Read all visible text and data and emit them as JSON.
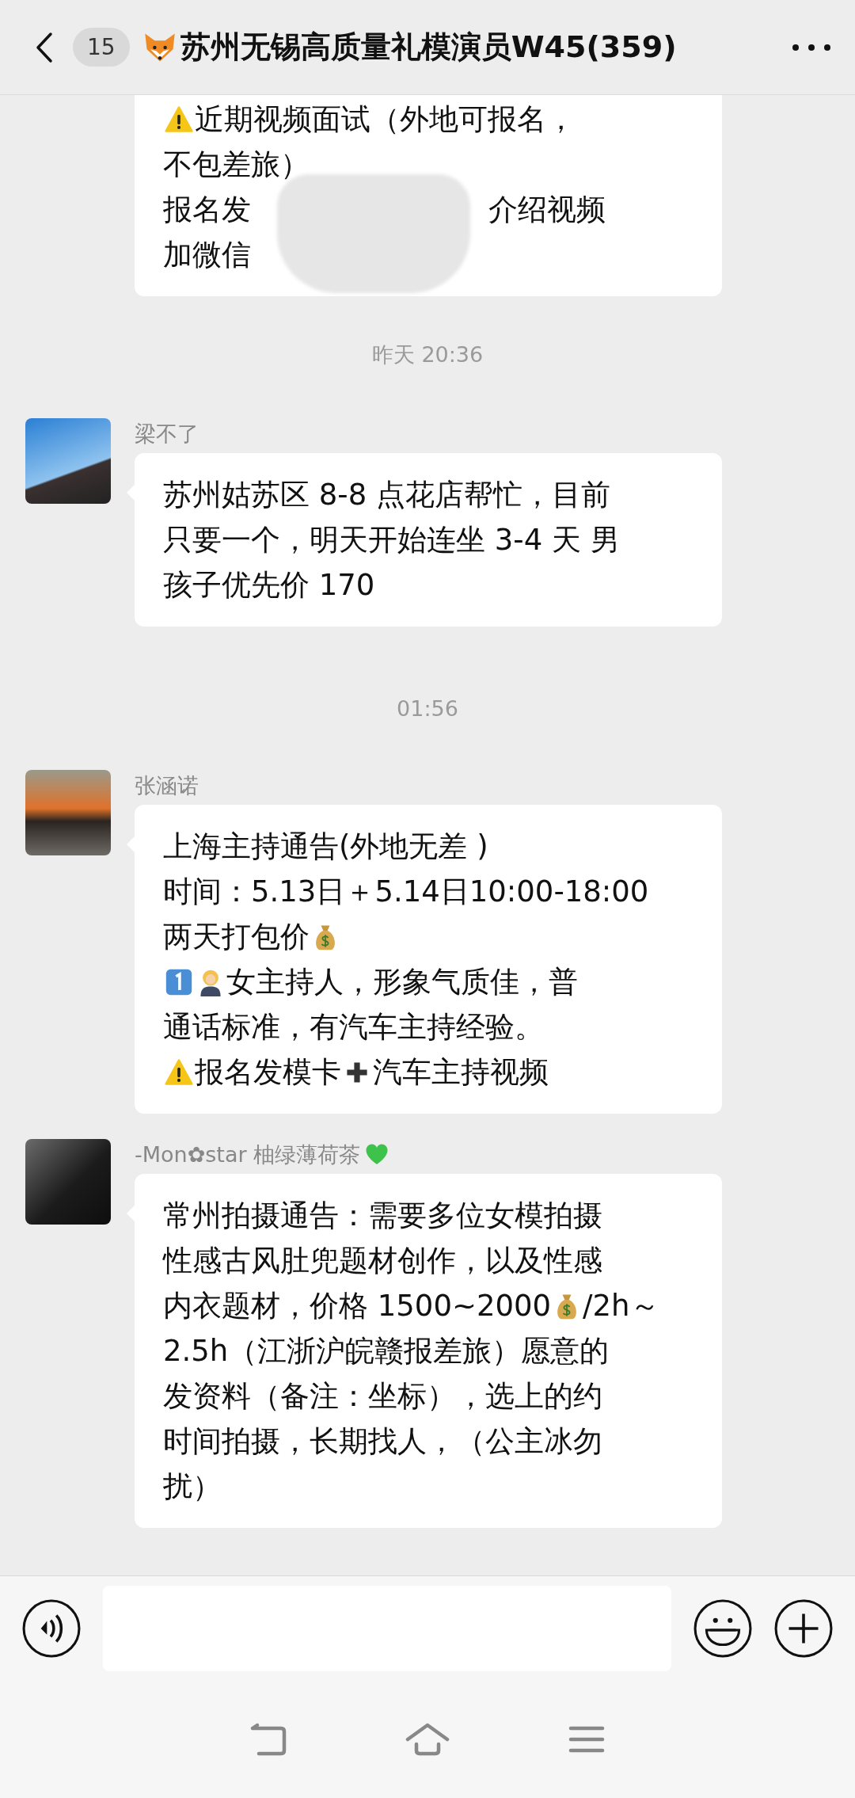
{
  "header": {
    "unread_count": "15",
    "title": "苏州无锡高质量礼模演员W45(359)"
  },
  "messages": [
    {
      "kind": "message",
      "redacted": true,
      "lines": [
        [
          {
            "kind": "warning"
          },
          {
            "kind": "text",
            "text": "近期视频面试（外地可报名，"
          }
        ],
        [
          {
            "kind": "text",
            "text": "不包差旅）"
          }
        ],
        [
          {
            "kind": "text",
            "text": "报名发"
          },
          {
            "kind": "hidden"
          },
          {
            "kind": "text",
            "text": "介绍视频"
          }
        ],
        [
          {
            "kind": "text",
            "text": "加微信"
          }
        ]
      ]
    },
    {
      "kind": "time",
      "text": "昨天 20:36"
    },
    {
      "kind": "message",
      "avatar": true,
      "sender": [
        {
          "kind": "text",
          "text": "梁不了"
        }
      ],
      "lines": [
        [
          {
            "kind": "text",
            "text": "苏州姑苏区 8-8 点花店帮忙，目前"
          }
        ],
        [
          {
            "kind": "text",
            "text": "只要一个，明天开始连坐 3-4 天 男"
          }
        ],
        [
          {
            "kind": "text",
            "text": "孩子优先价 170"
          }
        ]
      ]
    },
    {
      "kind": "time",
      "text": "01:56"
    },
    {
      "kind": "message",
      "avatar": true,
      "sender": [
        {
          "kind": "text",
          "text": "张涵诺"
        }
      ],
      "lines": [
        [
          {
            "kind": "text",
            "text": "上海主持通告(外地无差 )"
          }
        ],
        [
          {
            "kind": "text",
            "text": "时间：5.13日＋5.14日10:00-18:00"
          }
        ],
        [
          {
            "kind": "text",
            "text": "两天打包价"
          },
          {
            "kind": "money"
          }
        ],
        [
          {
            "kind": "keycap"
          },
          {
            "kind": "woman"
          },
          {
            "kind": "text",
            "text": "女主持人，形象气质佳，普"
          }
        ],
        [
          {
            "kind": "text",
            "text": "通话标准，有汽车主持经验。"
          }
        ],
        [
          {
            "kind": "warning"
          },
          {
            "kind": "text",
            "text": "报名发模卡"
          },
          {
            "kind": "plus"
          },
          {
            "kind": "text",
            "text": "汽车主持视频"
          }
        ]
      ]
    },
    {
      "kind": "message",
      "avatar": true,
      "sender": [
        {
          "kind": "text",
          "text": "-Mon✿star 柚绿薄荷茶"
        },
        {
          "kind": "heart"
        }
      ],
      "lines": [
        [
          {
            "kind": "text",
            "text": "常州拍摄通告：需要多位女模拍摄"
          }
        ],
        [
          {
            "kind": "text",
            "text": "性感古风肚兜题材创作，以及性感"
          }
        ],
        [
          {
            "kind": "text",
            "text": "内衣题材，价格 1500~2000"
          },
          {
            "kind": "money"
          },
          {
            "kind": "text",
            "text": "/2h～"
          }
        ],
        [
          {
            "kind": "text",
            "text": "2.5h（江浙沪皖赣报差旅）愿意的"
          }
        ],
        [
          {
            "kind": "text",
            "text": "发资料（备注：坐标），选上的约"
          }
        ],
        [
          {
            "kind": "text",
            "text": "时间拍摄，长期找人，（公主冰勿"
          }
        ],
        [
          {
            "kind": "text",
            "text": "扰）"
          }
        ]
      ]
    }
  ]
}
